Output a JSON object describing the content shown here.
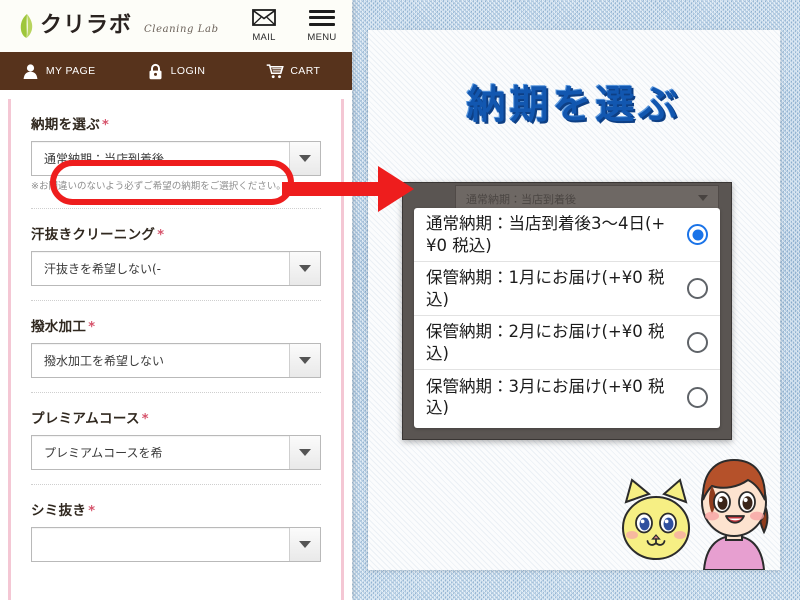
{
  "site": {
    "logo_jp": "クリラボ",
    "logo_en": "Cleaning Lab",
    "header_buttons": [
      {
        "label": "MAIL",
        "icon": "mail-icon"
      },
      {
        "label": "MENU",
        "icon": "hamburger-menu-icon"
      }
    ],
    "nav_items": [
      {
        "label": "MY PAGE",
        "icon": "user-icon"
      },
      {
        "label": "LOGIN",
        "icon": "lock-icon"
      },
      {
        "label": "CART",
        "icon": "cart-icon"
      }
    ],
    "nav_background": "#57331c"
  },
  "form": {
    "required_mark": "*",
    "fields": [
      {
        "label": "納期を選ぶ",
        "value": "通常納期：当店到着後",
        "hint": "※お間違いのないよう必ずご希望の納期をご選択ください。",
        "highlighted": true
      },
      {
        "label": "汗抜きクリーニング",
        "value": "汗抜きを希望しない(-",
        "hint": "",
        "highlighted": false
      },
      {
        "label": "撥水加工",
        "value": "撥水加工を希望しない",
        "hint": "",
        "highlighted": false
      },
      {
        "label": "プレミアムコース",
        "value": "プレミアムコースを希",
        "hint": "",
        "highlighted": false
      },
      {
        "label": "シミ抜き",
        "value": "",
        "hint": "",
        "highlighted": false
      }
    ],
    "highlight_color": "#ee1d1d"
  },
  "annotation": {
    "arrow_color": "#ee1d1d",
    "arrow_name": "red-pointer-arrow"
  },
  "slide": {
    "title": "納期を選ぶ",
    "title_color": "#1257b0",
    "dropdown": {
      "collapsed_value": "通常納期：当店到着後",
      "selected_index": 0,
      "accent_color": "#1a73e8",
      "options": [
        {
          "label": "通常納期：当店到着後3〜4日(+¥0 税込)",
          "selected": true
        },
        {
          "label": "保管納期：1月にお届け(+¥0 税込)",
          "selected": false
        },
        {
          "label": "保管納期：2月にお届け(+¥0 税込)",
          "selected": false
        },
        {
          "label": "保管納期：3月にお届け(+¥0 税込)",
          "selected": false
        }
      ]
    }
  },
  "mascots": {
    "cat_name": "yellow-cat-mascot",
    "girl_name": "girl-character-mascot",
    "cat_color": "#f6ef84",
    "hair_color": "#b5512a",
    "shirt_color": "#e79fd0"
  }
}
